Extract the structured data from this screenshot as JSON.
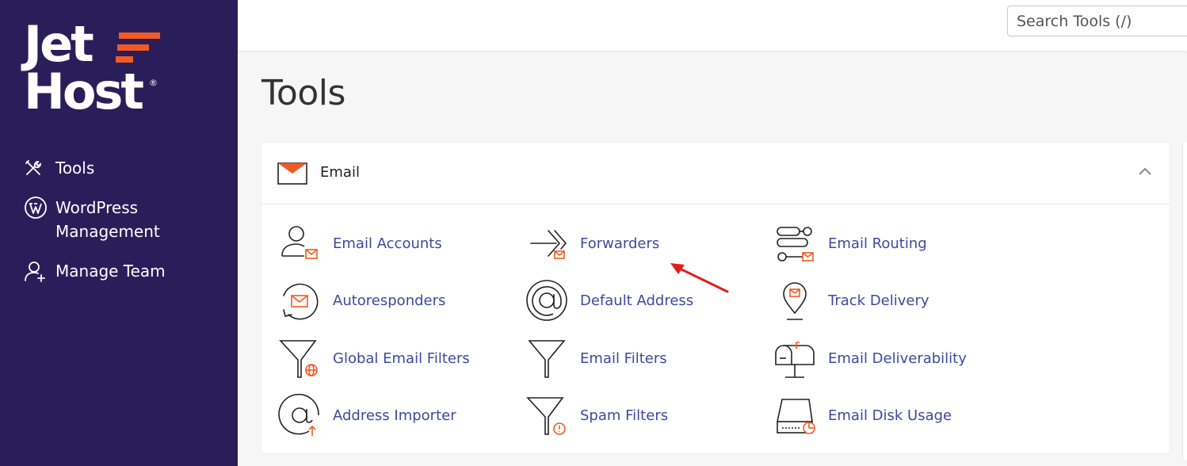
{
  "brand": {
    "logo_line1": "Jet",
    "logo_line2": "Host",
    "registered": "®",
    "accent_color": "#f15a24",
    "sidebar_color": "#2a1e5a"
  },
  "sidebar": {
    "items": [
      {
        "label": "Tools",
        "icon": "tools-icon"
      },
      {
        "label": "WordPress Management",
        "icon": "wordpress-icon"
      },
      {
        "label": "Manage Team",
        "icon": "add-user-icon"
      }
    ]
  },
  "topbar": {
    "search_placeholder": "Search Tools (/)"
  },
  "main": {
    "title": "Tools",
    "panel": {
      "title": "Email",
      "icon": "envelope-icon",
      "tools": [
        {
          "label": "Email Accounts",
          "icon": "email-accounts-icon"
        },
        {
          "label": "Forwarders",
          "icon": "forwarders-icon"
        },
        {
          "label": "Email Routing",
          "icon": "email-routing-icon"
        },
        {
          "label": "Autoresponders",
          "icon": "autoresponders-icon"
        },
        {
          "label": "Default Address",
          "icon": "at-sign-icon"
        },
        {
          "label": "Track Delivery",
          "icon": "map-pin-icon"
        },
        {
          "label": "Global Email Filters",
          "icon": "global-filter-icon"
        },
        {
          "label": "Email Filters",
          "icon": "filter-icon"
        },
        {
          "label": "Email Deliverability",
          "icon": "mailbox-icon"
        },
        {
          "label": "Address Importer",
          "icon": "address-importer-icon"
        },
        {
          "label": "Spam Filters",
          "icon": "spam-filter-icon"
        },
        {
          "label": "Email Disk Usage",
          "icon": "disk-usage-icon"
        }
      ]
    }
  }
}
